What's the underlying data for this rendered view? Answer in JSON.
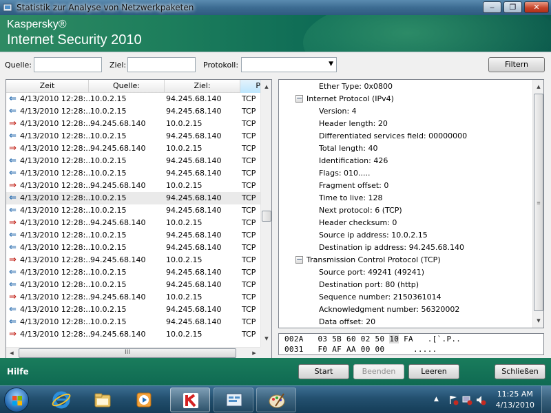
{
  "window": {
    "title": "Statistik zur Analyse von Netzwerkpaketen",
    "minimize": "‒",
    "maximize": "❐",
    "close": "✕"
  },
  "banner": {
    "brand": "Kaspersky®",
    "product": "Internet Security 2010"
  },
  "filter": {
    "source_label": "Quelle:",
    "source_value": "",
    "target_label": "Ziel:",
    "target_value": "",
    "protocol_label": "Protokoll:",
    "protocol_value": "",
    "filter_button": "Filtern"
  },
  "packet_list": {
    "columns": [
      "Zeit",
      "Quelle:",
      "Ziel:",
      "P"
    ],
    "highlight_row": 8,
    "rows": [
      {
        "dir": "in",
        "time": "4/13/2010 12:28:...",
        "source": "10.0.2.15",
        "target": "94.245.68.140",
        "protocol": "TCP"
      },
      {
        "dir": "in",
        "time": "4/13/2010 12:28:...",
        "source": "10.0.2.15",
        "target": "94.245.68.140",
        "protocol": "TCP"
      },
      {
        "dir": "out",
        "time": "4/13/2010 12:28:...",
        "source": "94.245.68.140",
        "target": "10.0.2.15",
        "protocol": "TCP"
      },
      {
        "dir": "in",
        "time": "4/13/2010 12:28:...",
        "source": "10.0.2.15",
        "target": "94.245.68.140",
        "protocol": "TCP"
      },
      {
        "dir": "out",
        "time": "4/13/2010 12:28:...",
        "source": "94.245.68.140",
        "target": "10.0.2.15",
        "protocol": "TCP"
      },
      {
        "dir": "in",
        "time": "4/13/2010 12:28:...",
        "source": "10.0.2.15",
        "target": "94.245.68.140",
        "protocol": "TCP"
      },
      {
        "dir": "in",
        "time": "4/13/2010 12:28:...",
        "source": "10.0.2.15",
        "target": "94.245.68.140",
        "protocol": "TCP"
      },
      {
        "dir": "out",
        "time": "4/13/2010 12:28:...",
        "source": "94.245.68.140",
        "target": "10.0.2.15",
        "protocol": "TCP"
      },
      {
        "dir": "in",
        "time": "4/13/2010 12:28:...",
        "source": "10.0.2.15",
        "target": "94.245.68.140",
        "protocol": "TCP"
      },
      {
        "dir": "in",
        "time": "4/13/2010 12:28:...",
        "source": "10.0.2.15",
        "target": "94.245.68.140",
        "protocol": "TCP"
      },
      {
        "dir": "out",
        "time": "4/13/2010 12:28:...",
        "source": "94.245.68.140",
        "target": "10.0.2.15",
        "protocol": "TCP"
      },
      {
        "dir": "in",
        "time": "4/13/2010 12:28:...",
        "source": "10.0.2.15",
        "target": "94.245.68.140",
        "protocol": "TCP"
      },
      {
        "dir": "in",
        "time": "4/13/2010 12:28:...",
        "source": "10.0.2.15",
        "target": "94.245.68.140",
        "protocol": "TCP"
      },
      {
        "dir": "out",
        "time": "4/13/2010 12:28:...",
        "source": "94.245.68.140",
        "target": "10.0.2.15",
        "protocol": "TCP"
      },
      {
        "dir": "in",
        "time": "4/13/2010 12:28:...",
        "source": "10.0.2.15",
        "target": "94.245.68.140",
        "protocol": "TCP"
      },
      {
        "dir": "in",
        "time": "4/13/2010 12:28:...",
        "source": "10.0.2.15",
        "target": "94.245.68.140",
        "protocol": "TCP"
      },
      {
        "dir": "out",
        "time": "4/13/2010 12:28:...",
        "source": "94.245.68.140",
        "target": "10.0.2.15",
        "protocol": "TCP"
      },
      {
        "dir": "in",
        "time": "4/13/2010 12:28:...",
        "source": "10.0.2.15",
        "target": "94.245.68.140",
        "protocol": "TCP"
      },
      {
        "dir": "in",
        "time": "4/13/2010 12:28:...",
        "source": "10.0.2.15",
        "target": "94.245.68.140",
        "protocol": "TCP"
      },
      {
        "dir": "out",
        "time": "4/13/2010 12:28:...",
        "source": "94.245.68.140",
        "target": "10.0.2.15",
        "protocol": "TCP"
      }
    ],
    "hscroll_grip": "III"
  },
  "details": {
    "nodes": [
      {
        "type": "leaf",
        "text": "Ether Type: 0x0800"
      },
      {
        "type": "parent",
        "text": "Internet Protocol (IPv4)"
      },
      {
        "type": "leaf",
        "text": "Version: 4"
      },
      {
        "type": "leaf",
        "text": "Header length: 20"
      },
      {
        "type": "leaf",
        "text": "Differentiated services field: 00000000"
      },
      {
        "type": "leaf",
        "text": "Total length: 40"
      },
      {
        "type": "leaf",
        "text": "Identification: 426"
      },
      {
        "type": "leaf",
        "text": "Flags: 010....."
      },
      {
        "type": "leaf",
        "text": "Fragment offset: 0"
      },
      {
        "type": "leaf",
        "text": "Time to live: 128"
      },
      {
        "type": "leaf",
        "text": "Next protocol: 6 (TCP)"
      },
      {
        "type": "leaf",
        "text": "Header checksum: 0"
      },
      {
        "type": "leaf",
        "text": "Source ip address: 10.0.2.15"
      },
      {
        "type": "leaf",
        "text": "Destination ip address: 94.245.68.140"
      },
      {
        "type": "parent",
        "text": "Transmission Control Protocol (TCP)"
      },
      {
        "type": "leaf",
        "text": "Source port: 49241 (49241)"
      },
      {
        "type": "leaf",
        "text": "Destination port: 80 (http)"
      },
      {
        "type": "leaf",
        "text": "Sequence number: 2150361014"
      },
      {
        "type": "leaf",
        "text": "Acknowledgment number: 56320002"
      },
      {
        "type": "leaf",
        "text": "Data offset: 20"
      }
    ],
    "toggle_symbol": "−"
  },
  "hex": {
    "lines": [
      {
        "offset": "002A",
        "pre": "03 5B 60 02 50 ",
        "sel": "10",
        "post": " FA",
        "ascii": ".[`.P.."
      },
      {
        "offset": "0031",
        "pre": "F0 AF AA 00 00",
        "sel": "",
        "post": "",
        "ascii": "....."
      }
    ]
  },
  "footer": {
    "help": "Hilfe",
    "start": "Start",
    "stop": "Beenden",
    "clear": "Leeren",
    "close": "Schließen"
  },
  "taskbar": {
    "time": "11:25 AM",
    "date": "4/13/2010"
  },
  "colors": {
    "incoming_arrow": "#2d6fb0",
    "outgoing_arrow": "#c42a20",
    "kaspersky_green": "#1d7e5c"
  }
}
